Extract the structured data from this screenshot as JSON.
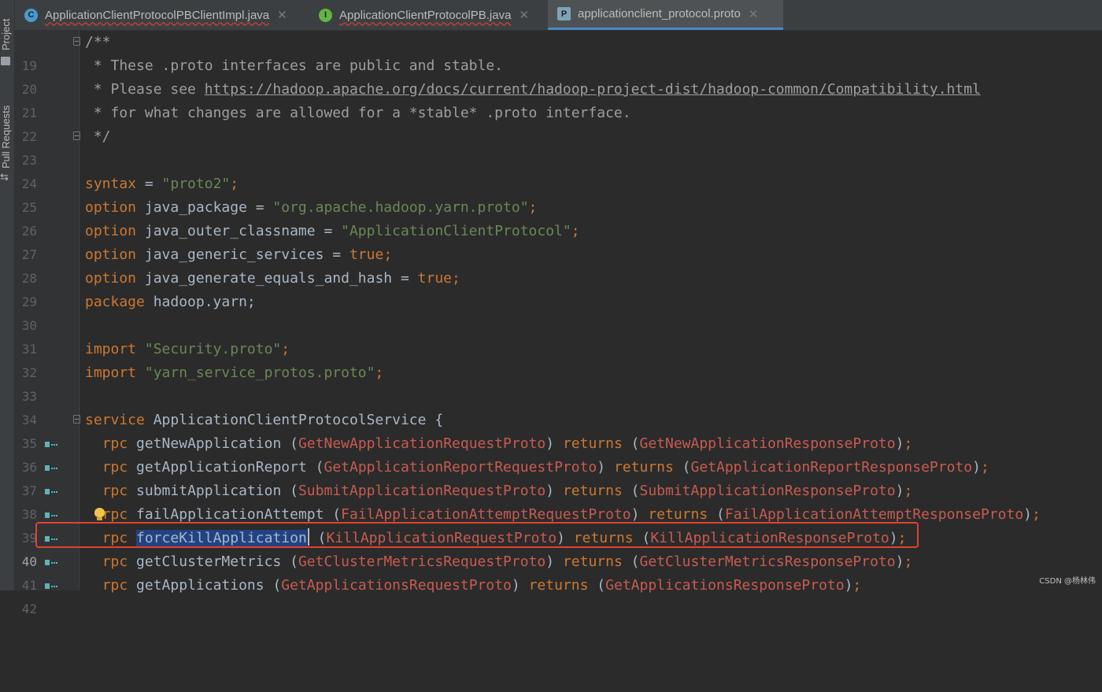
{
  "sidebar": {
    "project_label": "Project",
    "pull_requests_label": "Pull Requests"
  },
  "tabs": [
    {
      "label": "ApplicationClientProtocolPBClientImpl.java",
      "icon": "class-icon",
      "icon_letter": "C",
      "active": false
    },
    {
      "label": "ApplicationClientProtocolPB.java",
      "icon": "interface-icon",
      "icon_letter": "I",
      "active": false
    },
    {
      "label": "applicationclient_protocol.proto",
      "icon": "proto-file-icon",
      "icon_letter": "P",
      "active": true
    }
  ],
  "editor": {
    "current_line": 40,
    "selected_text": "forceKillApplication",
    "lines": [
      {
        "n": "19",
        "text": "/**"
      },
      {
        "n": "20",
        "text": " * These .proto interfaces are public and stable."
      },
      {
        "n": "21",
        "text_prefix": " * Please see ",
        "url": "https://hadoop.apache.org/docs/current/hadoop-project-dist/hadoop-common/Compatibility.html"
      },
      {
        "n": "22",
        "text": " * for what changes are allowed for a *stable* .proto interface."
      },
      {
        "n": "23",
        "text": " */"
      },
      {
        "n": "24",
        "text": ""
      },
      {
        "n": "25",
        "kw": "syntax",
        "mid": " = ",
        "str": "\"proto2\"",
        "end": ";"
      },
      {
        "n": "26",
        "kw": "option",
        "mid": " java_package = ",
        "str": "\"org.apache.hadoop.yarn.proto\"",
        "end": ";"
      },
      {
        "n": "27",
        "kw": "option",
        "mid": " java_outer_classname = ",
        "str": "\"ApplicationClientProtocol\"",
        "end": ";"
      },
      {
        "n": "28",
        "kw": "option",
        "mid": " java_generic_services = ",
        "val": "true",
        "end": ";"
      },
      {
        "n": "29",
        "kw": "option",
        "mid": " java_generate_equals_and_hash = ",
        "val": "true",
        "end": ";"
      },
      {
        "n": "30",
        "kw": "package",
        "mid": " hadoop.yarn;"
      },
      {
        "n": "31",
        "text": ""
      },
      {
        "n": "32",
        "kw": "import",
        "mid": " ",
        "str": "\"Security.proto\"",
        "end": ";"
      },
      {
        "n": "33",
        "kw": "import",
        "mid": " ",
        "str": "\"yarn_service_protos.proto\"",
        "end": ";"
      },
      {
        "n": "34",
        "text": ""
      },
      {
        "n": "35",
        "kw": "service",
        "mid": " ApplicationClientProtocolService {"
      },
      {
        "n": "36",
        "rpc": "getNewApplication",
        "req": "GetNewApplicationRequestProto",
        "res": "GetNewApplicationResponseProto"
      },
      {
        "n": "37",
        "rpc": "getApplicationReport",
        "req": "GetApplicationReportRequestProto",
        "res": "GetApplicationReportResponseProto"
      },
      {
        "n": "38",
        "rpc": "submitApplication",
        "req": "SubmitApplicationRequestProto",
        "res": "SubmitApplicationResponseProto"
      },
      {
        "n": "39",
        "rpc": "failApplicationAttempt",
        "req": "FailApplicationAttemptRequestProto",
        "res": "FailApplicationAttemptResponseProto"
      },
      {
        "n": "40",
        "rpc": "forceKillApplication",
        "req": "KillApplicationRequestProto",
        "res": "KillApplicationResponseProto"
      },
      {
        "n": "41",
        "rpc": "getClusterMetrics",
        "req": "GetClusterMetricsRequestProto",
        "res": "GetClusterMetricsResponseProto"
      },
      {
        "n": "42",
        "rpc": "getApplications",
        "req": "GetApplicationsRequestProto",
        "res": "GetApplicationsResponseProto"
      }
    ]
  },
  "keywords": {
    "rpc": "rpc",
    "returns": "returns"
  },
  "watermark": "CSDN @杨林伟",
  "colors": {
    "background": "#2b2b2b",
    "keyword": "#cc7832",
    "string": "#6a8759",
    "comment": "#9e9e9e",
    "type_ref": "#c85b52",
    "selection": "#214283",
    "annotation_box": "#e0432f",
    "active_tab_underline": "#4a88c7"
  }
}
